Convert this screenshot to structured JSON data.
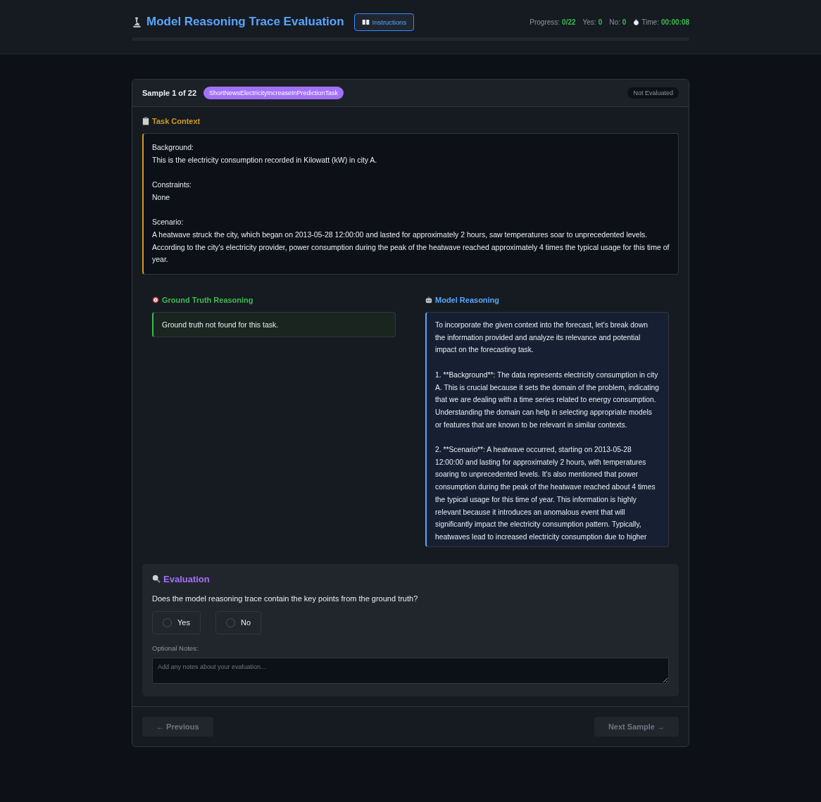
{
  "header": {
    "title": "Model Reasoning Trace Evaluation",
    "instructions_button": "Instructions",
    "stats": [
      {
        "label": "Progress:",
        "value": "0/22",
        "kind": "plain"
      },
      {
        "label": "Yes:",
        "value": "0",
        "kind": "plain"
      },
      {
        "label": "No:",
        "value": "0",
        "kind": "plain"
      },
      {
        "label": "Time:",
        "value": "00:00:08",
        "kind": "timer"
      }
    ],
    "progress": {
      "level": 0
    }
  },
  "sample": {
    "title": "Sample 1 of 22",
    "task_tag": "ShortNewsElectricityIncreaseInPredictionTask",
    "status": "Not Evaluated"
  },
  "task_context": {
    "heading": "Task Context",
    "sections": [
      {
        "label": "Background:",
        "text": "This is the electricity consumption recorded in Kilowatt (kW) in city A."
      },
      {
        "label": "Constraints:",
        "text": "None"
      },
      {
        "label": "Scenario:",
        "text": "A heatwave struck the city, which began on 2013-05-28 12:00:00 and lasted for approximately 2 hours, saw temperatures soar to unprecedented levels. According to the city's electricity provider, power consumption during the peak of the heatwave reached approximately 4 times the typical usage for this time of year."
      }
    ]
  },
  "ground_truth": {
    "heading": "Ground Truth Reasoning",
    "text": "Ground truth not found for this task."
  },
  "model_reasoning": {
    "heading": "Model Reasoning",
    "paragraphs": [
      "To incorporate the given context into the forecast, let's break down the information provided and analyze its relevance and potential impact on the forecasting task.",
      "1. **Background**: The data represents electricity consumption in city A. This is crucial because it sets the domain of the problem, indicating that we are dealing with a time series related to energy consumption. Understanding the domain can help in selecting appropriate models or features that are known to be relevant in similar contexts.",
      "2. **Scenario**: A heatwave occurred, starting on 2013-05-28 12:00:00 and lasting for approximately 2 hours, with temperatures soaring to unprecedented levels. It's also mentioned that power consumption during the peak of the heatwave reached about 4 times the typical usage for this time of year. This information is highly relevant because it introduces an anomalous event that will significantly impact the electricity consumption pattern. Typically, heatwaves lead to increased electricity consumption due to higher"
    ]
  },
  "evaluation": {
    "heading": "Evaluation",
    "question": "Does the model reasoning trace contain the key points from the ground truth?",
    "options": [
      {
        "label": "Yes",
        "selected": false
      },
      {
        "label": "No",
        "selected": false
      }
    ],
    "notes_label": "Optional Notes:",
    "notes_placeholder": "Add any notes about your evaluation..."
  },
  "nav": {
    "previous": {
      "label": "← Previous",
      "disabled": true
    },
    "next": {
      "label": "Next Sample →",
      "disabled": true
    }
  }
}
